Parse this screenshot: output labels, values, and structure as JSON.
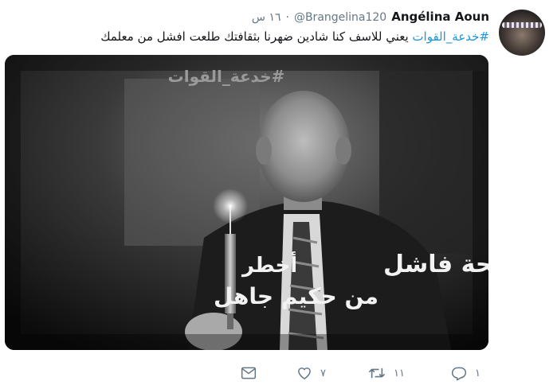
{
  "tweet": {
    "author_name": "Angélina Aoun",
    "handle": "@Brangelina120",
    "separator": "·",
    "time": "١٦ س",
    "hashtag": "#خدعة_القوات",
    "body": " يعني للاسف كنا شادين ضهرنا بثقافتك طلعت افشل من معلمك"
  },
  "media": {
    "hashtag_overlay": "#خدعة_القوات",
    "caption_line1": "وزير صحة فاشل",
    "caption_line2": "أخطر",
    "caption_line3": "من حكيم جاهل"
  },
  "actions": {
    "reply_count": "١",
    "retweet_count": "١١",
    "like_count": "٧"
  },
  "colors": {
    "link": "#1b95e0",
    "muted": "#657786",
    "text": "#14171a"
  },
  "icons": {
    "reply": "reply-icon",
    "retweet": "retweet-icon",
    "like": "heart-icon",
    "dm": "mail-icon"
  }
}
